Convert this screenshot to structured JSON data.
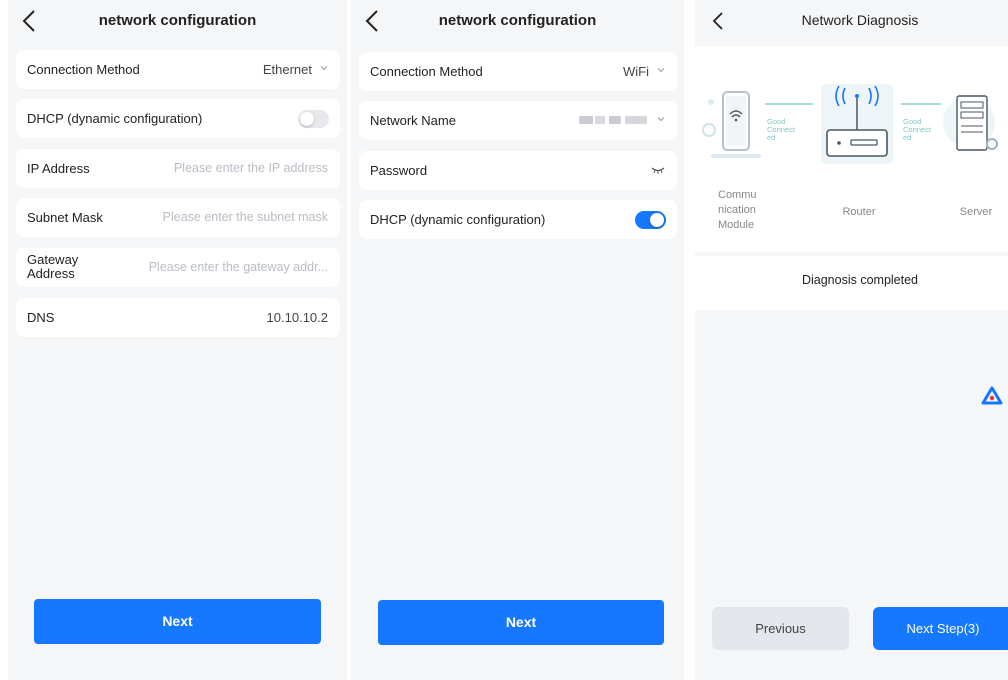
{
  "screen1": {
    "title": "network configuration",
    "connection_method": {
      "label": "Connection Method",
      "value": "Ethernet"
    },
    "dhcp": {
      "label": "DHCP (dynamic configuration)",
      "enabled": false
    },
    "ip_address": {
      "label": "IP Address",
      "placeholder": "Please enter the IP address"
    },
    "subnet_mask": {
      "label": "Subnet Mask",
      "placeholder": "Please enter the subnet mask"
    },
    "gateway": {
      "label_line1": "Gateway",
      "label_line2": "Address",
      "placeholder": "Please enter the gateway addr..."
    },
    "dns": {
      "label": "DNS",
      "value": "10.10.10.2"
    },
    "next_label": "Next"
  },
  "screen2": {
    "title": "network configuration",
    "connection_method": {
      "label": "Connection Method",
      "value": "WiFi"
    },
    "network_name": {
      "label": "Network Name"
    },
    "password": {
      "label": "Password"
    },
    "dhcp": {
      "label": "DHCP (dynamic configuration)",
      "enabled": true
    },
    "next_label": "Next"
  },
  "screen3": {
    "title": "Network Diagnosis",
    "nodes": {
      "module_line1": "Commu",
      "module_line2": "nication",
      "module_line3": "Module",
      "router": "Router",
      "server": "Server"
    },
    "connections": {
      "left_line1": "Good",
      "left_line2": "Connect",
      "left_line3": "ed",
      "right_line1": "Good",
      "right_line2": "Connect",
      "right_line3": "ed"
    },
    "status": "Diagnosis completed",
    "previous_label": "Previous",
    "next_step_label": "Next Step(3)"
  },
  "colors": {
    "accent": "#1677ff",
    "page_bg": "#f5f6f8",
    "connection_ok": "#7fc6c6"
  }
}
